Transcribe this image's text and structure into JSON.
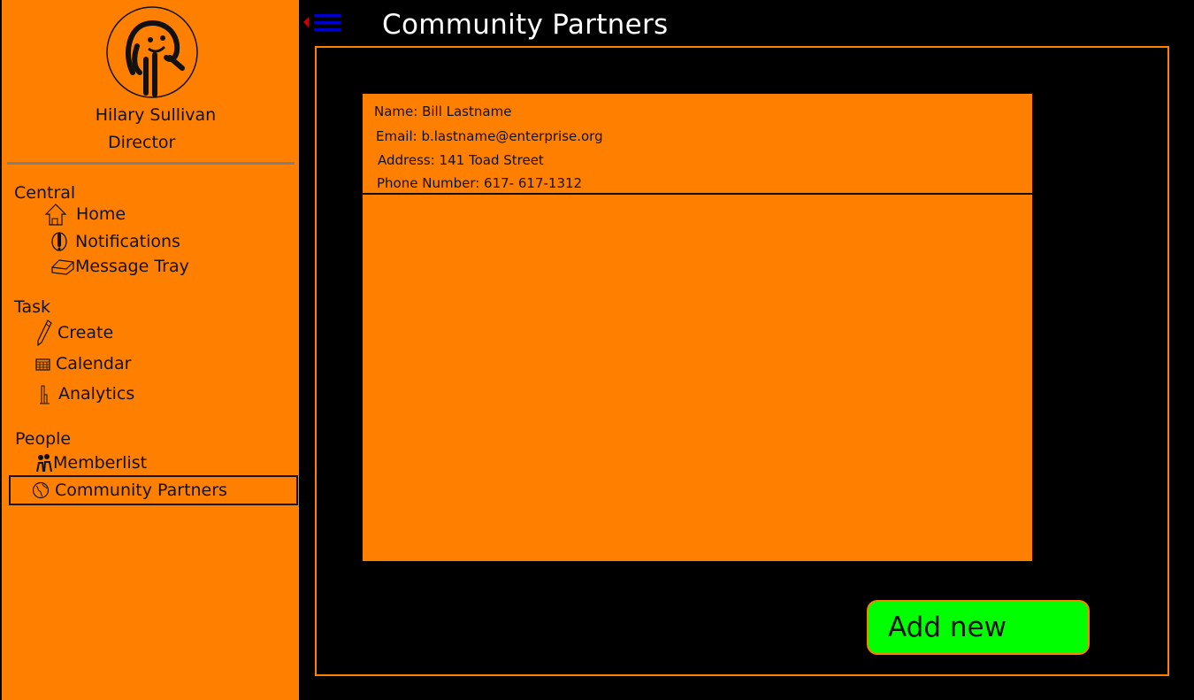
{
  "user": {
    "name": "Hilary Sullivan",
    "role": "Director"
  },
  "header": {
    "title": "Community Partners"
  },
  "nav": {
    "central": {
      "title": "Central",
      "items": [
        {
          "label": "Home",
          "icon": "house-icon"
        },
        {
          "label": "Notifications",
          "icon": "bell-icon"
        },
        {
          "label": "Message Tray",
          "icon": "tray-icon"
        }
      ]
    },
    "task": {
      "title": "Task",
      "items": [
        {
          "label": "Create",
          "icon": "pencil-icon"
        },
        {
          "label": "Calendar",
          "icon": "calendar-icon"
        },
        {
          "label": "Analytics",
          "icon": "bar-chart-icon"
        }
      ]
    },
    "people": {
      "title": "People",
      "items": [
        {
          "label": "Memberlist",
          "icon": "people-icon"
        },
        {
          "label": "Community Partners",
          "icon": "globe-icon",
          "active": true
        }
      ]
    }
  },
  "partner": {
    "name": "Name: Bill Lastname",
    "email": "Email: b.lastname@enterprise.org",
    "address": "Address: 141 Toad Street",
    "phone": "Phone Number: 617- 617-1312"
  },
  "actions": {
    "add_new_label": "Add new"
  },
  "colors": {
    "sidebar": "#ff8000",
    "background": "#000000",
    "accent_button": "#00ff00",
    "menu_toggle": "#0000cc",
    "menu_arrow": "#cc0000"
  }
}
